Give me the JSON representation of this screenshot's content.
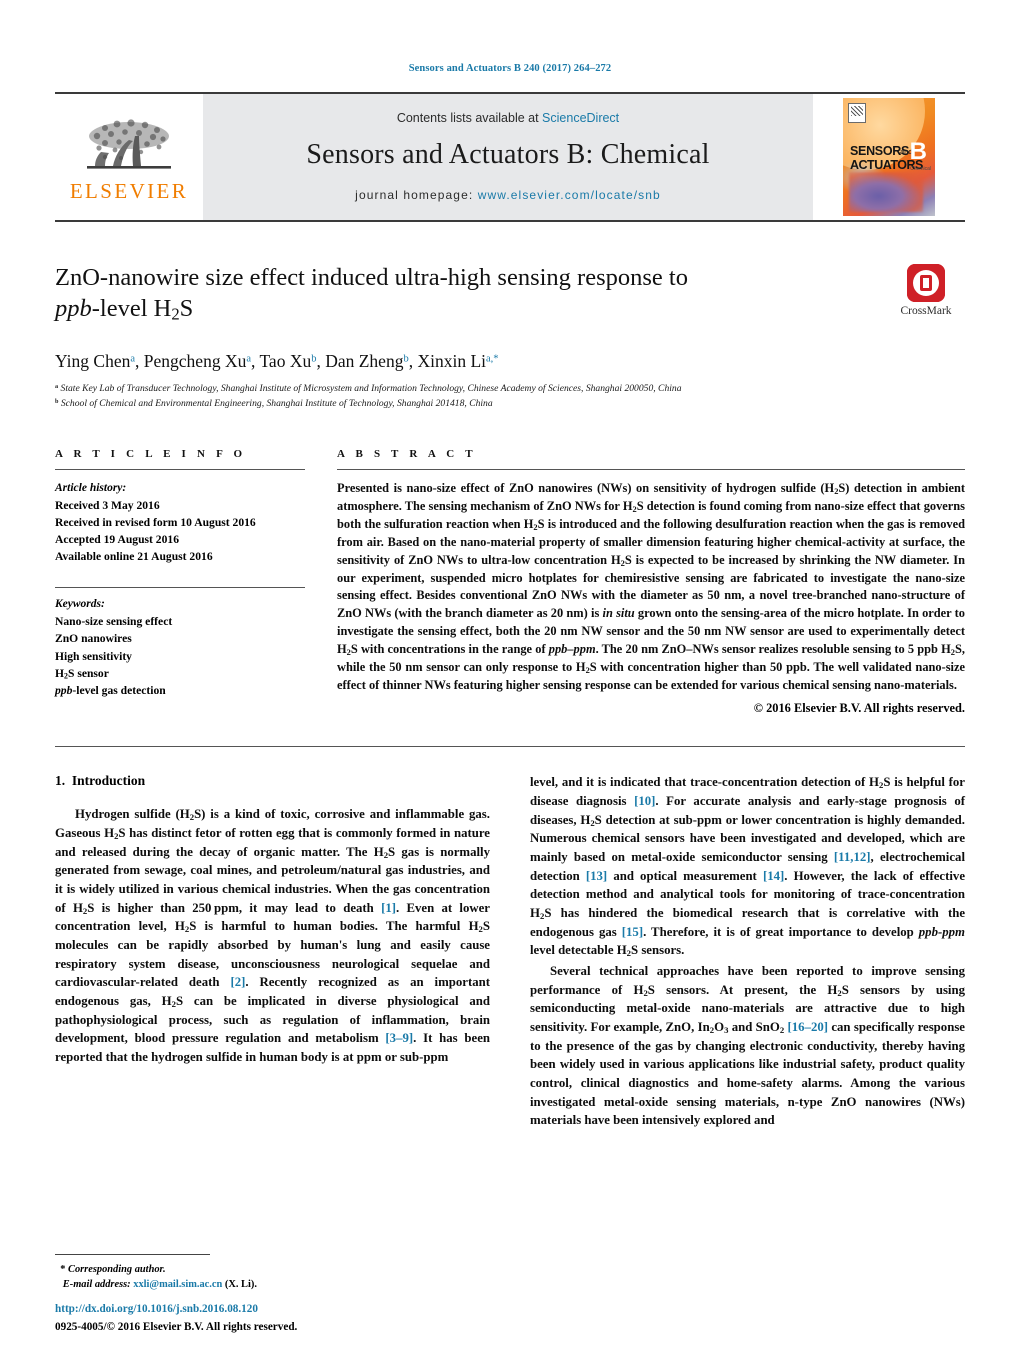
{
  "running_head": "Sensors and Actuators B 240 (2017) 264–272",
  "masthead": {
    "publisher_name": "ELSEVIER",
    "contents_prefix": "Contents lists available at ",
    "contents_link": "ScienceDirect",
    "journal_title": "Sensors and Actuators B: Chemical",
    "homepage_label": "journal homepage:",
    "homepage_url": "www.elsevier.com/locate/snb",
    "cover": {
      "line1": "SENSORS",
      "line2": "ACTUATORS",
      "and": "and",
      "letter": "B",
      "sublabel": "Chemical"
    }
  },
  "article": {
    "title_line1": "ZnO-nanowire size effect induced ultra-high sensing response to",
    "title_italic": "ppb",
    "title_line2_rest": "-level H",
    "title_sub": "2",
    "title_tail": "S",
    "crossmark_label": "CrossMark",
    "authors": [
      {
        "name": "Ying Chen",
        "sup": "a"
      },
      {
        "name": "Pengcheng Xu",
        "sup": "a"
      },
      {
        "name": "Tao Xu",
        "sup": "b"
      },
      {
        "name": "Dan Zheng",
        "sup": "b"
      },
      {
        "name": "Xinxin Li",
        "sup": "a,*"
      }
    ],
    "affiliations": [
      {
        "marker": "a",
        "text": "State Key Lab of Transducer Technology, Shanghai Institute of Microsystem and Information Technology, Chinese Academy of Sciences, Shanghai 200050, China"
      },
      {
        "marker": "b",
        "text": "School of Chemical and Environmental Engineering, Shanghai Institute of Technology, Shanghai 201418, China"
      }
    ]
  },
  "article_info": {
    "heading": "A R T I C L E    I N F O",
    "history_label": "Article history:",
    "history": [
      "Received 3 May 2016",
      "Received in revised form 10 August 2016",
      "Accepted 19 August 2016",
      "Available online 21 August 2016"
    ],
    "keywords_label": "Keywords:",
    "keywords": [
      "Nano-size sensing effect",
      "ZnO nanowires",
      "High sensitivity",
      "H2S sensor",
      "ppb-level gas detection"
    ]
  },
  "abstract": {
    "heading": "A B S T R A C T",
    "text_parts": [
      "Presented is nano-size effect of ZnO nanowires (NWs) on sensitivity of hydrogen sulfide (H",
      "2",
      "S) detection in ambient atmosphere. The sensing mechanism of ZnO NWs for H",
      "2",
      "S detection is found coming from nano-size effect that governs both the sulfuration reaction when H",
      "2",
      "S is introduced and the following desulfuration reaction when the gas is removed from air. Based on the nano-material property of smaller dimension featuring higher chemical-activity at surface, the sensitivity of ZnO NWs to ultra-low concentration H",
      "2",
      "S is expected to be increased by shrinking the NW diameter. In our experiment, suspended micro hotplates for chemiresistive sensing are fabricated to investigate the nano-size sensing effect. Besides conventional ZnO NWs with the diameter as 50 nm, a novel tree-branched nano-structure of ZnO NWs (with the branch diameter as 20 nm) is ",
      "in situ",
      " grown onto the sensing-area of the micro hotplate. In order to investigate the sensing effect, both the 20 nm NW sensor and the 50 nm NW sensor are used to experimentally detect H",
      "2",
      "S with concentrations in the range of ",
      "ppb–ppm",
      ". The 20 nm ZnO–NWs sensor realizes resoluble sensing to 5 ppb H",
      "2",
      "S, while the 50 nm sensor can only response to H",
      "2",
      "S with concentration higher than 50 ppb. The well validated nano-size effect of thinner NWs featuring higher sensing response can be extended for various chemical sensing nano-materials."
    ],
    "copyright": "© 2016 Elsevier B.V. All rights reserved."
  },
  "introduction": {
    "section_number": "1.",
    "section_title": "Introduction",
    "left_paragraph_1": "Hydrogen sulfide (H2S) is a kind of toxic, corrosive and inflammable gas. Gaseous H2S has distinct fetor of rotten egg that is commonly formed in nature and released during the decay of organic matter. The H2S gas is normally generated from sewage, coal mines, and petroleum/natural gas industries, and it is widely utilized in various chemical industries. When the gas concentration of H2S is higher than 250 ppm, it may lead to death [1]. Even at lower concentration level, H2S is harmful to human bodies. The harmful H2S molecules can be rapidly absorbed by human's lung and easily cause respiratory system disease, unconsciousness neurological sequelae and cardiovascular-related death [2]. Recently recognized as an important endogenous gas, H2S can be implicated in diverse physiological and pathophysiological process, such as regulation of inflammation, brain development, blood pressure regulation and metabolism [3–9]. It has been reported that the hydrogen sulfide in human body is at ppm or sub-ppm",
    "right_paragraph_1": "level, and it is indicated that trace-concentration detection of H2S is helpful for disease diagnosis [10]. For accurate analysis and early-stage prognosis of diseases, H2S detection at sub-ppm or lower concentration is highly demanded. Numerous chemical sensors have been investigated and developed, which are mainly based on metal-oxide semiconductor sensing [11,12], electrochemical detection [13] and optical measurement [14]. However, the lack of effective detection method and analytical tools for monitoring of trace-concentration H2S has hindered the biomedical research that is correlative with the endogenous gas [15]. Therefore, it is of great importance to develop ppb-ppm level detectable H2S sensors.",
    "right_paragraph_2": "Several technical approaches have been reported to improve sensing performance of H2S sensors. At present, the H2S sensors by using semiconducting metal-oxide nano-materials are attractive due to high sensitivity. For example, ZnO, In2O3 and SnO2 [16–20] can specifically response to the presence of the gas by changing electronic conductivity, thereby having been widely used in various applications like industrial safety, product quality control, clinical diagnostics and home-safety alarms. Among the various investigated metal-oxide sensing materials, n-type ZnO nanowires (NWs) materials have been intensively explored and"
  },
  "footer": {
    "corresponding_marker": "*",
    "corresponding_label": "Corresponding author.",
    "email_label": "E-mail address:",
    "email": "xxli@mail.sim.ac.cn",
    "email_owner": "(X. Li).",
    "doi": "http://dx.doi.org/10.1016/j.snb.2016.08.120",
    "issn_line": "0925-4005/© 2016 Elsevier B.V. All rights reserved."
  },
  "colors": {
    "link": "#1a7aa8",
    "elsevier_orange": "#f07d00",
    "crossmark_red": "#cf2027",
    "masthead_bg": "#e7e8ea"
  }
}
